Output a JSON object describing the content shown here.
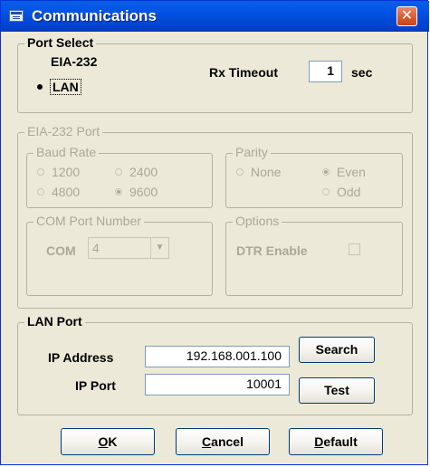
{
  "window": {
    "title": "Communications",
    "close_label": "✕"
  },
  "port_select": {
    "label": "Port Select",
    "options": [
      "EIA-232",
      "LAN"
    ],
    "selected": "LAN",
    "rx_timeout_label": "Rx Timeout",
    "rx_timeout_value": "1",
    "rx_timeout_unit": "sec"
  },
  "eia232": {
    "label": "EIA-232 Port",
    "baud": {
      "label": "Baud Rate",
      "options": [
        "1200",
        "2400",
        "4800",
        "9600"
      ],
      "selected": "9600"
    },
    "parity": {
      "label": "Parity",
      "options": [
        "None",
        "Even",
        "Odd"
      ],
      "selected": "Even"
    },
    "com": {
      "label": "COM Port Number",
      "prefix": "COM",
      "value": "4"
    },
    "options": {
      "label": "Options",
      "dtr_label": "DTR Enable",
      "dtr_checked": false
    }
  },
  "lan": {
    "label": "LAN Port",
    "ip_address_label": "IP Address",
    "ip_address_value": "192.168.001.100",
    "ip_port_label": "IP Port",
    "ip_port_value": "10001",
    "search_label": "Search",
    "test_label": "Test"
  },
  "buttons": {
    "ok": "OK",
    "cancel": "Cancel",
    "default": "Default"
  }
}
